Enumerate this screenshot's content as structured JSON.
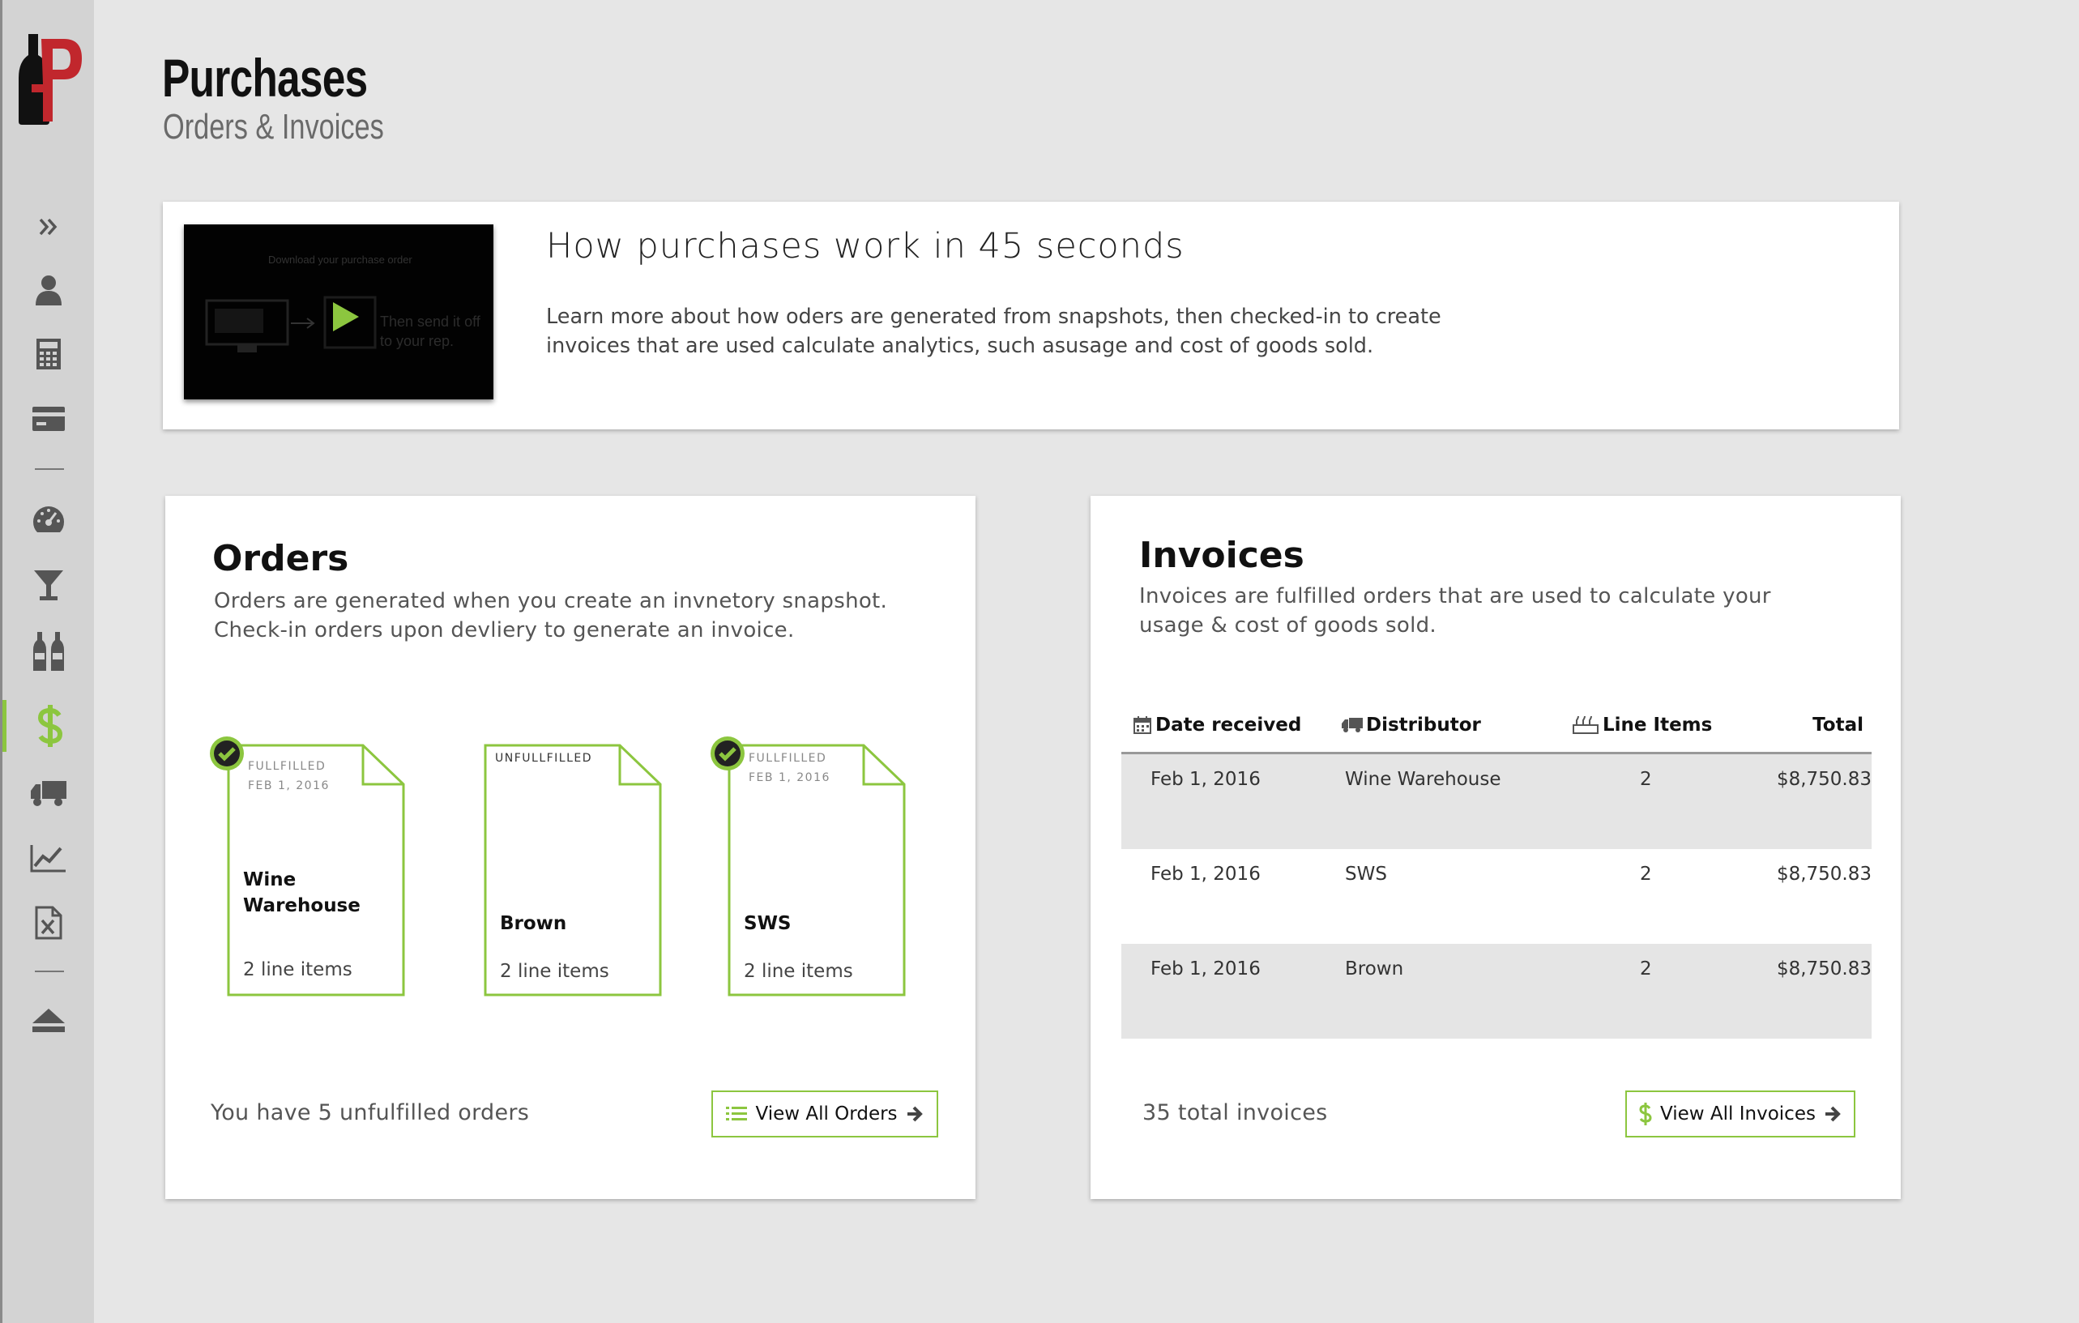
{
  "header": {
    "title": "Purchases",
    "subtitle": "Orders & Invoices"
  },
  "sidebar": {
    "items": [
      {
        "icon": "expand-chevrons-icon"
      },
      {
        "icon": "user-icon"
      },
      {
        "icon": "calculator-icon"
      },
      {
        "icon": "credit-card-icon"
      },
      {
        "icon": "dashboard-gauge-icon"
      },
      {
        "icon": "cocktail-glass-icon"
      },
      {
        "icon": "bottles-icon"
      },
      {
        "icon": "dollar-icon",
        "active": true
      },
      {
        "icon": "truck-icon"
      },
      {
        "icon": "line-chart-icon"
      },
      {
        "icon": "excel-file-icon"
      },
      {
        "icon": "eject-icon"
      }
    ]
  },
  "video": {
    "title": "How purchases work in 45 seconds",
    "description": "Learn more about how oders are generated from snapshots, then checked-in to create invoices that are used calculate analytics, such asusage and cost of goods sold.",
    "thumb_caption_top": "Download your purchase order",
    "thumb_caption_side": "Then send it off to your rep."
  },
  "orders": {
    "title": "Orders",
    "description": "Orders are generated when you create an invnetory snapshot. Check-in orders upon devliery to generate an invoice.",
    "documents": [
      {
        "status": "FULLFILLED",
        "date": "FEB 1, 2016",
        "name": "Wine Warehouse",
        "items": "2 line items",
        "fulfilled": true
      },
      {
        "status": "UNFULLFILLED",
        "date": "",
        "name": "Brown",
        "items": "2 line items",
        "fulfilled": false
      },
      {
        "status": "FULLFILLED",
        "date": "FEB 1, 2016",
        "name": "SWS",
        "items": "2 line items",
        "fulfilled": true
      }
    ],
    "footer": "You have 5 unfulfilled orders",
    "button": "View All Orders"
  },
  "invoices": {
    "title": "Invoices",
    "description": "Invoices are fulfilled orders that are used to calculate your usage & cost of goods sold.",
    "columns": [
      "Date received",
      "Distributor",
      "Line Items",
      "Total"
    ],
    "rows": [
      {
        "date": "Feb 1, 2016",
        "distributor": "Wine Warehouse",
        "items": "2",
        "total": "$8,750.83"
      },
      {
        "date": "Feb 1, 2016",
        "distributor": "SWS",
        "items": "2",
        "total": "$8,750.83"
      },
      {
        "date": "Feb 1, 2016",
        "distributor": "Brown",
        "items": "2",
        "total": "$8,750.83"
      }
    ],
    "footer": "35 total invoices",
    "button": "View All Invoices"
  },
  "colors": {
    "accent": "#8cc63f",
    "brand_red": "#c1272d",
    "sidebar": "#d3d3d3",
    "background": "#e6e6e6"
  }
}
